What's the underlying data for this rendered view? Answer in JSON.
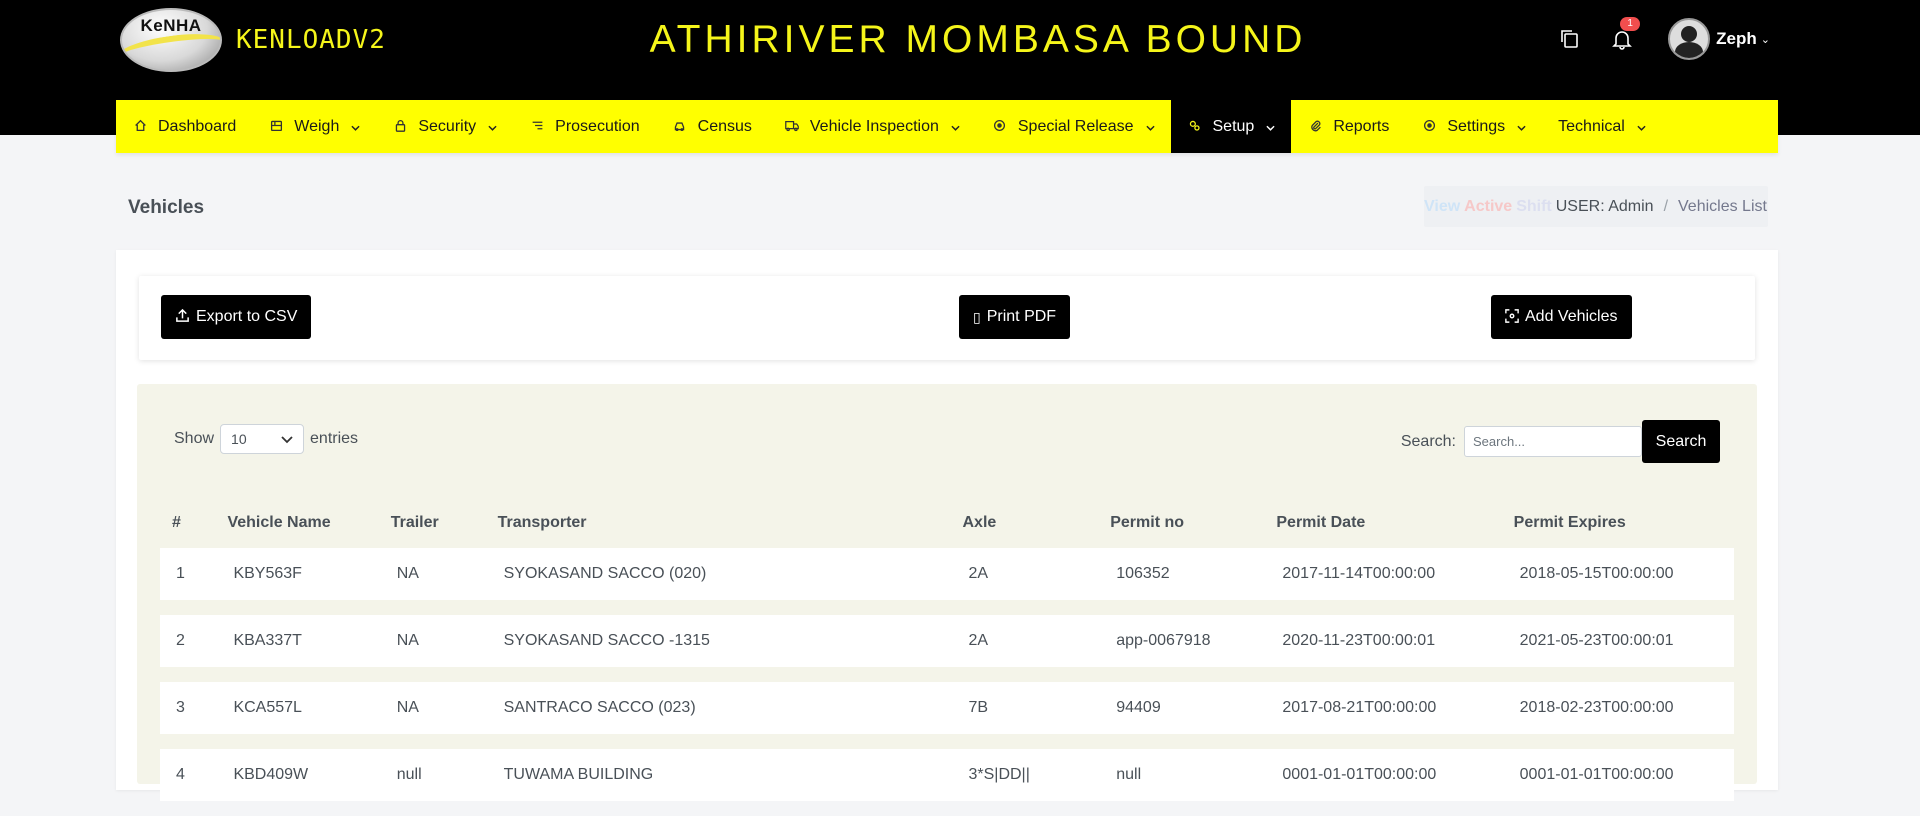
{
  "header": {
    "logo_text": "KeNHA",
    "app_name": "KENLOADV2",
    "station_title": "ATHIRIVER MOMBASA BOUND",
    "notification_count": "1",
    "username": "Zeph"
  },
  "nav": [
    {
      "label": "Dashboard",
      "icon": "home-icon",
      "has_caret": false
    },
    {
      "label": "Weigh",
      "icon": "scale-icon",
      "has_caret": true
    },
    {
      "label": "Security",
      "icon": "lock-icon",
      "has_caret": true
    },
    {
      "label": "Prosecution",
      "icon": "list-icon",
      "has_caret": false
    },
    {
      "label": "Census",
      "icon": "car-icon",
      "has_caret": false
    },
    {
      "label": "Vehicle Inspection",
      "icon": "truck-icon",
      "has_caret": true
    },
    {
      "label": "Special Release",
      "icon": "circle-dot-icon",
      "has_caret": true
    },
    {
      "label": "Setup",
      "icon": "gears-icon",
      "has_caret": true,
      "active": true
    },
    {
      "label": "Reports",
      "icon": "paperclip-icon",
      "has_caret": false
    },
    {
      "label": "Settings",
      "icon": "circle-dot-icon",
      "has_caret": true
    },
    {
      "label": "Technical",
      "icon": "",
      "has_caret": true
    }
  ],
  "page": {
    "title": "Vehicles",
    "breadcrumb": {
      "faded_1": "View",
      "faded_2": "Active",
      "faded_3": "Shift",
      "user": "USER: Admin",
      "current": "Vehicles List"
    }
  },
  "actions": {
    "export_label": "Export to CSV",
    "print_label": "Print PDF",
    "add_label": "Add Vehicles"
  },
  "table_controls": {
    "show_label": "Show",
    "page_size": "10",
    "entries_label": "entries",
    "search_label": "Search:",
    "search_placeholder": "Search...",
    "search_button": "Search"
  },
  "table": {
    "headers": [
      "#",
      "Vehicle Name",
      "Trailer",
      "Transporter",
      "Axle",
      "Permit no",
      "Permit Date",
      "Permit Expires"
    ],
    "rows": [
      [
        "1",
        "KBY563F",
        "NA",
        "SYOKASAND SACCO (020)",
        "2A",
        "106352",
        "2017-11-14T00:00:00",
        "2018-05-15T00:00:00"
      ],
      [
        "2",
        "KBA337T",
        "NA",
        "SYOKASAND SACCO -1315",
        "2A",
        "app-0067918",
        "2020-11-23T00:00:01",
        "2021-05-23T00:00:01"
      ],
      [
        "3",
        "KCA557L",
        "NA",
        "SANTRACO SACCO (023)",
        "7B",
        "94409",
        "2017-08-21T00:00:00",
        "2018-02-23T00:00:00"
      ],
      [
        "4",
        "KBD409W",
        "null",
        "TUWAMA BUILDING",
        "3*S|DD||",
        "null",
        "0001-01-01T00:00:00",
        "0001-01-01T00:00:00"
      ]
    ]
  },
  "colors": {
    "nav_background": "#ffff00",
    "header_background": "#000000",
    "title_yellow": "#f5f51a",
    "table_panel": "#f4f4e9"
  }
}
